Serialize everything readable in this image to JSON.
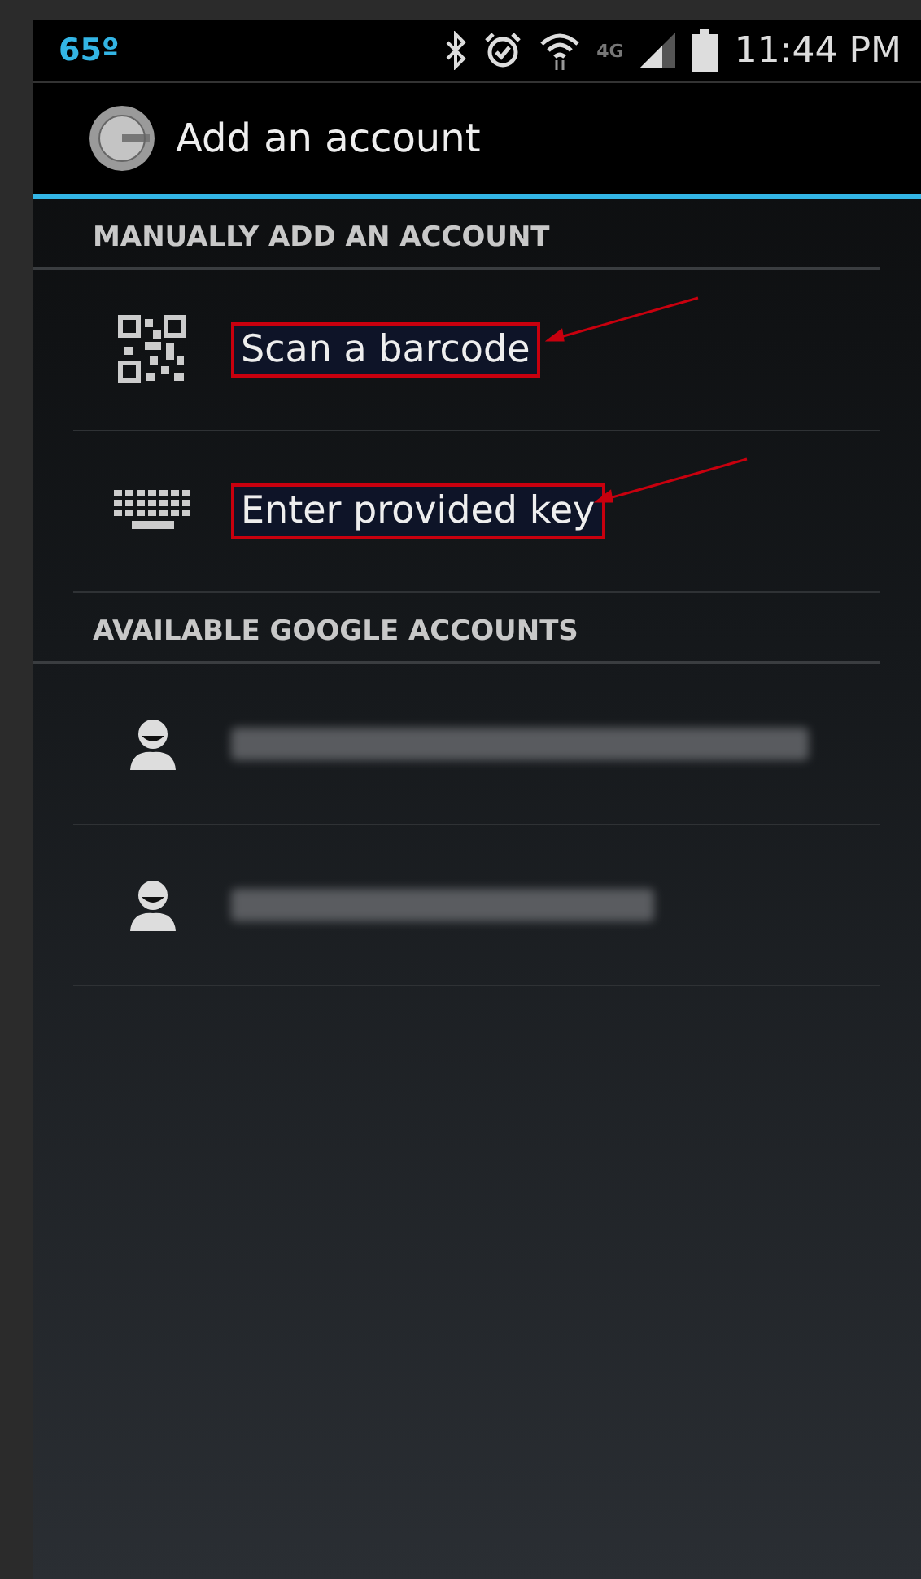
{
  "status_bar": {
    "temperature": "65º",
    "network": "4G",
    "time": "11:44 PM"
  },
  "action_bar": {
    "title": "Add an account"
  },
  "manual_section": {
    "header": "MANUALLY ADD AN ACCOUNT",
    "items": [
      {
        "kind": "barcode",
        "label": "Scan a barcode",
        "annotated": true
      },
      {
        "kind": "keyboard",
        "label": "Enter provided key",
        "annotated": true
      }
    ]
  },
  "accounts_section": {
    "header": "AVAILABLE GOOGLE ACCOUNTS",
    "items": [
      {
        "kind": "redacted"
      },
      {
        "kind": "redacted"
      }
    ]
  }
}
